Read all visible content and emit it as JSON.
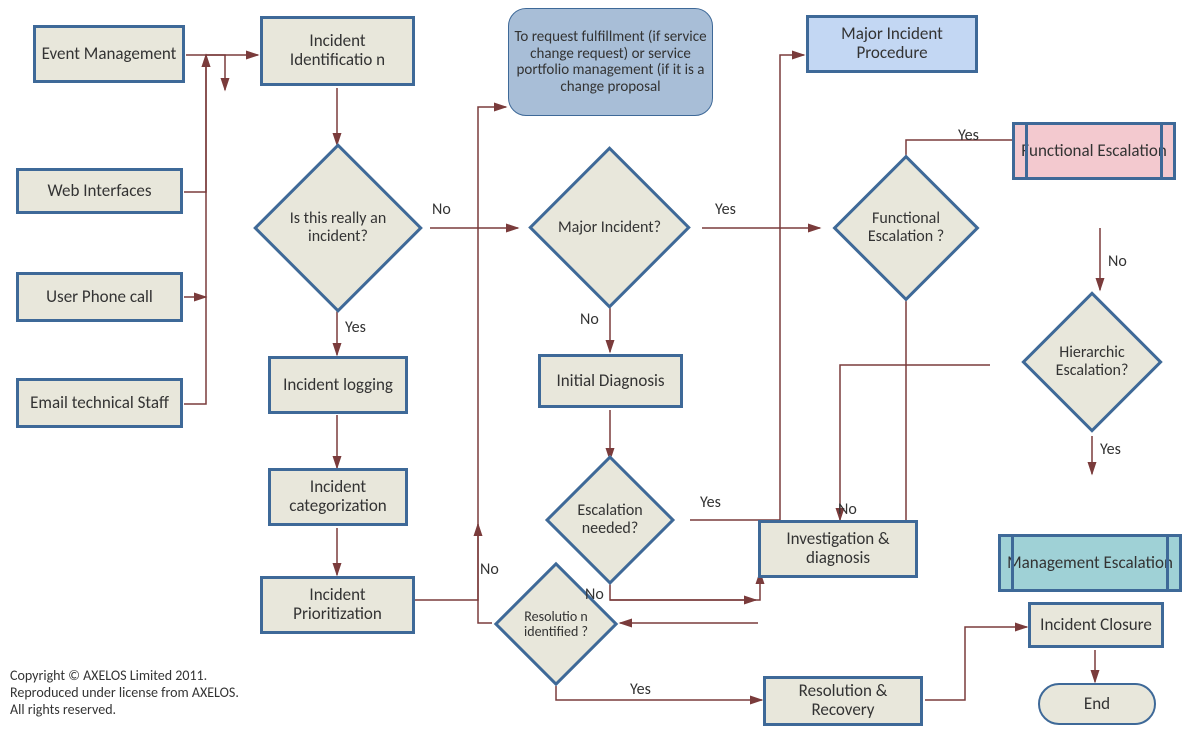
{
  "boxes": {
    "event_mgmt": "Event Management",
    "web_if": "Web Interfaces",
    "user_phone": "User Phone call",
    "email_staff": "Email technical Staff",
    "incident_id": "Incident Identificatio n",
    "is_incident": "Is this really an incident?",
    "incident_log": "Incident logging",
    "incident_cat": "Incident categorization",
    "incident_pri": "Incident Prioritization",
    "request_fulfill": "To request fulfillment (if service change request) or service portfolio management (if it is a change proposal",
    "major_incident_q": "Major Incident?",
    "initial_diag": "Initial Diagnosis",
    "escalation_needed": "Escalation needed?",
    "resolution_ident": "Resolutio n identified ?",
    "investigation": "Investigation & diagnosis",
    "resolution_rec": "Resolution  & Recovery",
    "major_incident_proc": "Major Incident Procedure",
    "functional_esc_q": "Functional Escalation ?",
    "functional_esc": "Functional Escalation",
    "hierarchic_esc": "Hierarchic Escalation?",
    "mgmt_esc": "Management Escalation",
    "incident_closure": "Incident Closure",
    "end": "End"
  },
  "labels": {
    "yes": "Yes",
    "no": "No"
  },
  "copyright": "Copyright © AXELOS Limited 2011. Reproduced under license from AXELOS. All rights reserved."
}
